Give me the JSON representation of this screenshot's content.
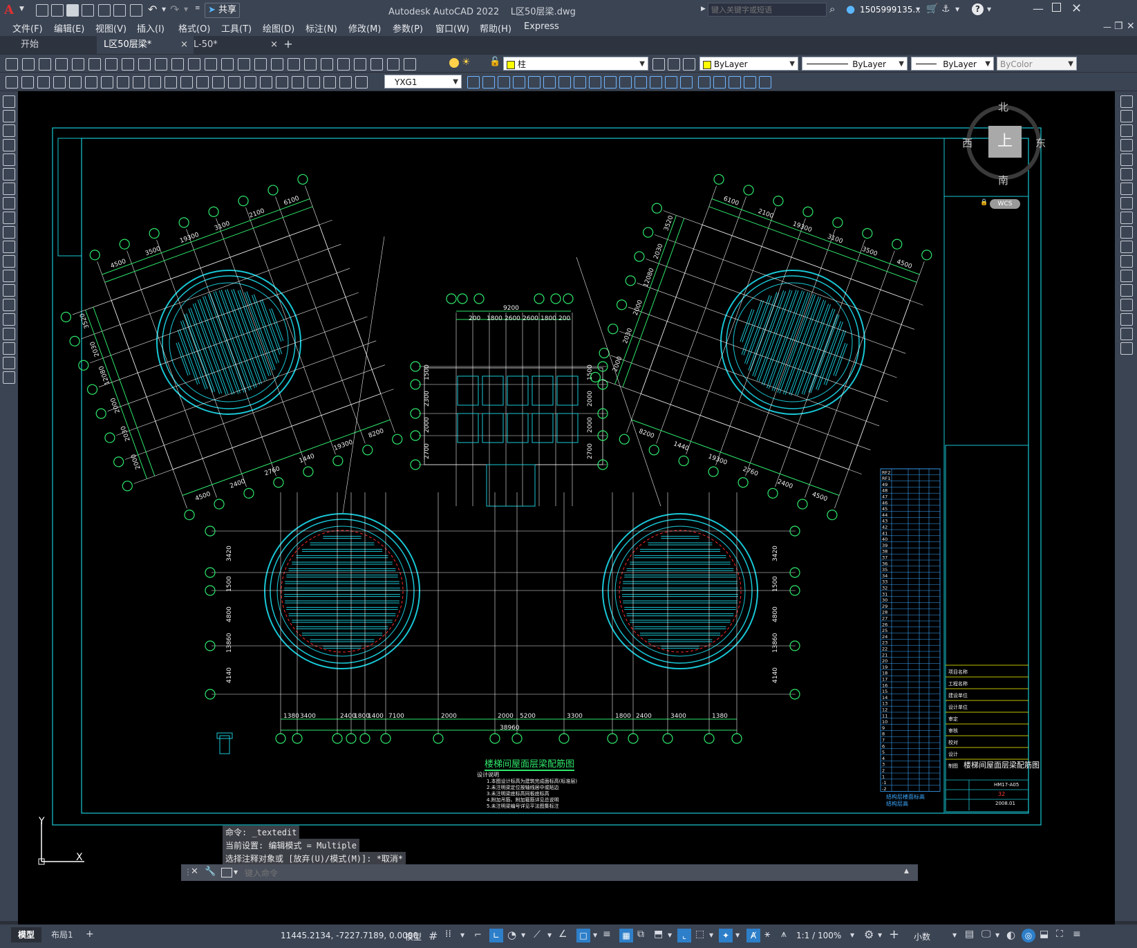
{
  "app": {
    "logo": "A",
    "share_label": "共享",
    "title": "Autodesk AutoCAD 2022    L区50层梁.dwg",
    "search_placeholder": "键入关键字或短语",
    "user": "1505999135...",
    "help": "?"
  },
  "menu": [
    "文件(F)",
    "编辑(E)",
    "视图(V)",
    "插入(I)",
    "格式(O)",
    "工具(T)",
    "绘图(D)",
    "标注(N)",
    "修改(M)",
    "参数(P)",
    "窗口(W)",
    "帮助(H)",
    "Express"
  ],
  "tabs": [
    {
      "label": "开始"
    },
    {
      "label": "L区50层梁*",
      "close": "×"
    },
    {
      "label": "L-50*",
      "close": "×"
    }
  ],
  "tab_add": "+",
  "layer": {
    "name": "柱",
    "color": "#ffff00"
  },
  "props": {
    "color": "ByLayer",
    "linetype": "ByLayer",
    "lineweight": "ByLayer",
    "plotstyle": "ByColor"
  },
  "textstyle": "YXG1",
  "viewcube": {
    "north": "北",
    "south": "南",
    "east": "东",
    "west": "西",
    "top": "上",
    "wcs": "WCS"
  },
  "drawing": {
    "main_title": "楼梯间屋面层梁配筋图",
    "notes_title": "设计说明",
    "notes": [
      "1.本图设计标高为建筑完成面标高(标准层)",
      "2.未注明梁定位按轴线居中或贴边",
      "3.未注明梁底标高同板底标高",
      "4.附加吊筋、附加箍筋详见总说明",
      "5.未注明梁编号详见平法图集标注"
    ],
    "dims_top_left": [
      "4500",
      "3500",
      "19300",
      "3100",
      "2100",
      "6100"
    ],
    "dims_left_side": [
      "3520",
      "2030",
      "12080",
      "2000",
      "2030",
      "2000"
    ],
    "dims_bottom_left": [
      "4500",
      "2400",
      "2760",
      "1440",
      "19300",
      "8200"
    ],
    "dims_top_right": [
      "6100",
      "2100",
      "19300",
      "3100",
      "3500",
      "4500"
    ],
    "dims_right_side": [
      "3520",
      "2030",
      "12080",
      "2000",
      "2030",
      "2000"
    ],
    "dims_bottom_right": [
      "8200",
      "1440",
      "19300",
      "2760",
      "2400",
      "4500"
    ],
    "core_top_dims": [
      "9200",
      "200",
      "1800",
      "2600",
      "2600",
      "1800",
      "200"
    ],
    "core_left_dims": [
      "1500",
      "2300",
      "2000",
      "2700"
    ],
    "core_right_dims": [
      "1500",
      "2000",
      "2000",
      "2700"
    ],
    "bottom_dims": [
      "1380",
      "3400",
      "2400",
      "1800",
      "1400",
      "7100",
      "2000",
      "2000",
      "5200",
      "3300",
      "1800",
      "2400",
      "3400",
      "1380"
    ],
    "bottom_total": "38960",
    "left_vert_dims": [
      "3420",
      "1500",
      "4800",
      "13860",
      "4140"
    ],
    "right_vert_dims": [
      "3420",
      "1500",
      "4800",
      "13860",
      "4140"
    ],
    "grid_bubbles_bottom": [
      "2-1",
      "L1",
      "L2",
      "2-2",
      "L3",
      "L4",
      "2-3",
      "L5",
      "L6",
      "2-4",
      "L7",
      "L8",
      "L9",
      "2-5"
    ],
    "grid_bubbles_left": [
      "L-A",
      "L-B",
      "L-C",
      "L-D",
      "L-E"
    ],
    "table_title": "结构层楼面标高 结构层高",
    "title_block": {
      "drawing_name": "楼梯间屋面层梁配筋图",
      "number": "HM17-A05",
      "sheet": "32",
      "date": "2008.01",
      "rows": [
        "项目名称",
        "工程名称",
        "建设单位",
        "设计单位",
        "审定",
        "审核",
        "校对",
        "设计",
        "制图"
      ]
    },
    "floor_table_rows": [
      "RF2",
      "RF1",
      "49",
      "48",
      "47",
      "46",
      "45",
      "44",
      "43",
      "42",
      "41",
      "40",
      "39",
      "38",
      "37",
      "36",
      "35",
      "34",
      "33",
      "32",
      "31",
      "30",
      "29",
      "28",
      "27",
      "26",
      "25",
      "24",
      "23",
      "22",
      "21",
      "20",
      "19",
      "18",
      "17",
      "16",
      "15",
      "14",
      "13",
      "12",
      "11",
      "10",
      "9",
      "8",
      "7",
      "6",
      "5",
      "4",
      "3",
      "2",
      "1",
      "-1",
      "-2"
    ]
  },
  "command": {
    "line1": "命令: _textedit",
    "line2": "当前设置: 编辑模式 = Multiple",
    "line3": "选择注释对象或 [放弃(U)/模式(M)]: *取消*",
    "placeholder": "键入命令"
  },
  "layout_tabs": [
    "模型",
    "布局1"
  ],
  "layout_add": "+",
  "status": {
    "coords": "11445.2134, -7227.7189, 0.0000",
    "model": "模型",
    "scale": "1:1 / 100%",
    "units": "小数"
  },
  "ucs": {
    "x": "X",
    "y": "Y"
  }
}
